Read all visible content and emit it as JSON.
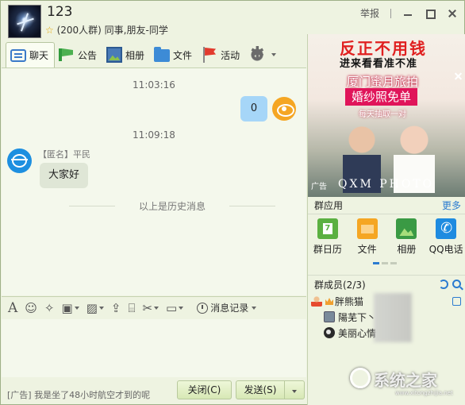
{
  "header": {
    "group_name": "123",
    "group_info": "(200人群) 同事,朋友-同学",
    "report_label": "举报"
  },
  "tabs": [
    {
      "label": "聊天",
      "icon": "chat-icon",
      "active": true
    },
    {
      "label": "公告",
      "icon": "notice-icon"
    },
    {
      "label": "相册",
      "icon": "album-icon"
    },
    {
      "label": "文件",
      "icon": "folder-icon"
    },
    {
      "label": "活动",
      "icon": "flag-icon"
    },
    {
      "label": "",
      "icon": "gear-icon"
    }
  ],
  "chat": {
    "time1": "11:03:16",
    "my_message": "0",
    "time2": "11:09:18",
    "sender_name": "【匿名】平民",
    "other_message": "大家好",
    "history_divider": "以上是历史消息"
  },
  "input_toolbar": {
    "tools": [
      "font-icon",
      "emoji-icon",
      "magic-icon",
      "gift-box-icon",
      "screenshot-icon",
      "upload-icon",
      "gift-icon",
      "scissors-icon",
      "more-icon"
    ],
    "history_label": "消息记录"
  },
  "footer": {
    "ad_text": "[广告] 我是坐了48小时航空才到的呢",
    "close_label": "关闭(C)",
    "send_label": "发送(S)"
  },
  "ad": {
    "headline": "反正不用钱",
    "subline": "进来看看准不准",
    "promo_title": "厦门蜜月旅拍",
    "promo_badge": "婚纱照免单",
    "promo_note": "每天抽取一对",
    "tag": "广告",
    "brand": "QXM PHOTO"
  },
  "apps": {
    "title": "群应用",
    "more": "更多",
    "items": [
      {
        "label": "群日历",
        "icon": "calendar-icon",
        "color": "#5bb041"
      },
      {
        "label": "文件",
        "icon": "folder-icon",
        "color": "#f5a623"
      },
      {
        "label": "相册",
        "icon": "album-icon",
        "color": "#3a9a44"
      },
      {
        "label": "QQ电话",
        "icon": "phone-icon",
        "color": "#1e8be0"
      }
    ]
  },
  "members": {
    "title": "群成员(2/3)",
    "list": [
      {
        "name": "胖熊猫",
        "role": "owner"
      },
      {
        "name": "陽芜下丶",
        "role": "member"
      },
      {
        "name": "美丽心情",
        "role": "member"
      }
    ]
  },
  "watermark": {
    "text": "系统之家",
    "url": "www.xitongzhijia.net"
  }
}
